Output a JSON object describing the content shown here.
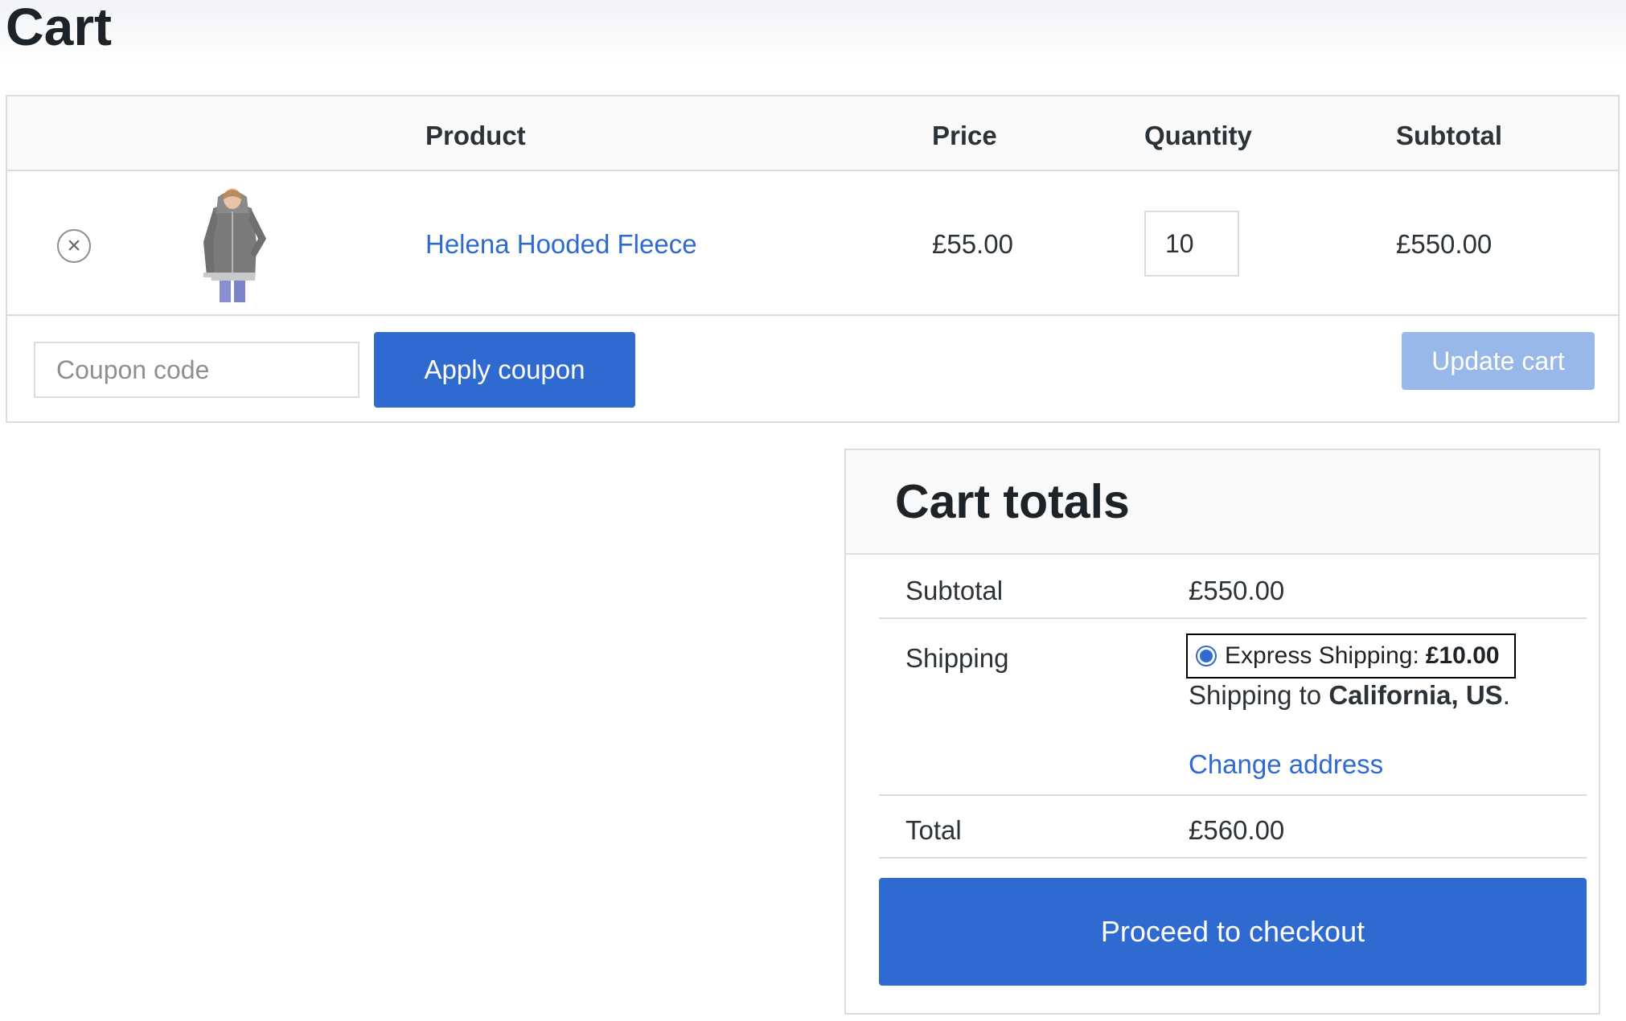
{
  "page": {
    "title": "Cart"
  },
  "cart_table": {
    "headers": {
      "product": "Product",
      "price": "Price",
      "quantity": "Quantity",
      "subtotal": "Subtotal"
    },
    "items": [
      {
        "remove_icon": "close-circle-icon",
        "image": "hooded-fleece-thumbnail",
        "name": "Helena Hooded Fleece",
        "price": "£55.00",
        "quantity": "10",
        "subtotal": "£550.00"
      }
    ]
  },
  "actions": {
    "coupon_placeholder": "Coupon code",
    "apply_coupon_label": "Apply coupon",
    "update_cart_label": "Update cart"
  },
  "totals": {
    "title": "Cart totals",
    "subtotal_label": "Subtotal",
    "subtotal_value": "£550.00",
    "shipping_label": "Shipping",
    "shipping_method": "Express Shipping:",
    "shipping_cost": "£10.00",
    "shipping_to_prefix": "Shipping to",
    "shipping_destination": "California, US",
    "shipping_to_suffix": ".",
    "change_address_label": "Change address",
    "total_label": "Total",
    "total_value": "£560.00",
    "checkout_label": "Proceed to checkout"
  },
  "colors": {
    "accent": "#2f6ad0",
    "accent_disabled": "#98b8ea",
    "border": "#dcdcde",
    "text": "#2c3338"
  }
}
